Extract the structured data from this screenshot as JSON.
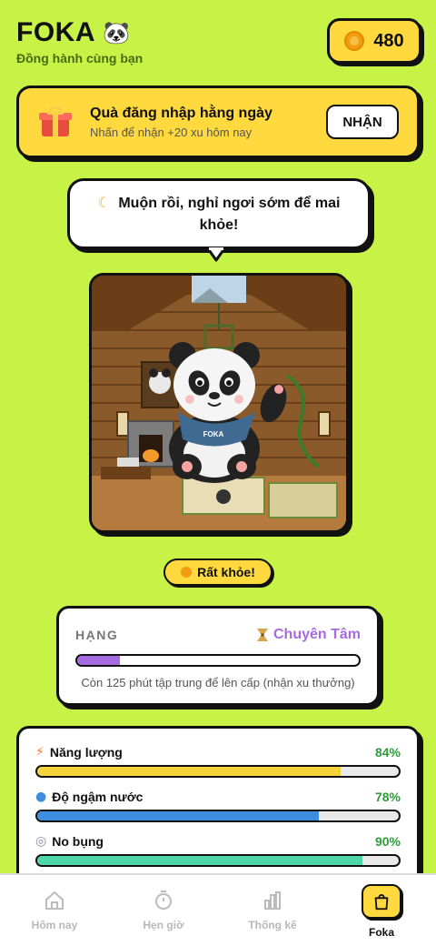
{
  "header": {
    "title": "FOKA",
    "title_emoji": "🐼",
    "subtitle": "Đồng hành cùng bạn"
  },
  "coins": {
    "value": "480",
    "icon": "coin-icon"
  },
  "daily_gift": {
    "title": "Quà đăng nhập hằng ngày",
    "subtitle": "Nhấn để nhận +20 xu hôm nay",
    "button_label": "NHẬN",
    "icon": "gift-icon"
  },
  "speech": {
    "icon": "moon-icon",
    "text": "Muộn rồi, nghỉ ngơi sớm để mai khỏe!"
  },
  "mascot": {
    "scarf_text": "FOKA"
  },
  "status": {
    "label": "Rất khỏe!",
    "icon": "smile-icon"
  },
  "rank": {
    "label": "HẠNG",
    "value": "Chuyên Tâm",
    "progress": 0.15,
    "note": "Còn 125 phút tập trung để lên cấp (nhận xu thưởng)",
    "color": "#a66ae3"
  },
  "stats": [
    {
      "icon": "lightning-icon",
      "name": "Năng lượng",
      "pct_label": "84%",
      "value": 84,
      "color": "#f4d23a"
    },
    {
      "icon": "water-drop-icon",
      "name": "Độ ngậm nước",
      "pct_label": "78%",
      "value": 78,
      "color": "#3d8ee0"
    },
    {
      "icon": "plate-icon",
      "name": "No bụng",
      "pct_label": "90%",
      "value": 90,
      "color": "#4fd6a8"
    }
  ],
  "tabs": [
    {
      "label": "Hôm nay",
      "icon": "home-icon",
      "active": false
    },
    {
      "label": "Hẹn giờ",
      "icon": "timer-icon",
      "active": false
    },
    {
      "label": "Thống kê",
      "icon": "chart-icon",
      "active": false
    },
    {
      "label": "Foka",
      "icon": "bag-icon",
      "active": true
    }
  ]
}
